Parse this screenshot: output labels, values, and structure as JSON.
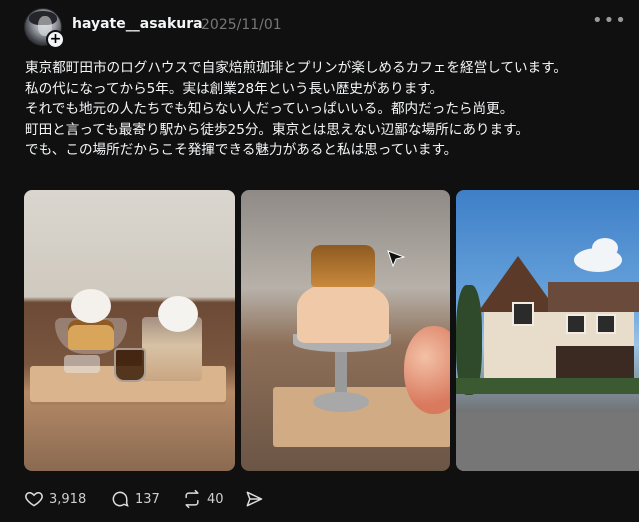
{
  "post": {
    "username": "hayate__asakura",
    "date": "2025/11/01",
    "text": "東京都町田市のログハウスで自家焙煎珈琲とプリンが楽しめるカフェを経営しています。\n私の代になってから5年。実は創業28年という長い歴史があります。\nそれでも地元の人たちでも知らない人だっていっぱいいる。都内だったら尚更。\n町田と言っても最寄り駅から徒歩25分。東京とは思えない辺鄙な場所にあります。\nでも、この場所だからこそ発揮できる魅力があると私は思っています。"
  },
  "images": [
    {
      "icon": "pudding-dessert-photo"
    },
    {
      "icon": "peach-pudding-photo"
    },
    {
      "icon": "log-house-cafe-photo"
    }
  ],
  "actions": {
    "likes": "3,918",
    "replies": "137",
    "reposts": "40"
  },
  "colors": {
    "background": "#101010",
    "text": "#f3f5f7",
    "muted": "#777777"
  }
}
